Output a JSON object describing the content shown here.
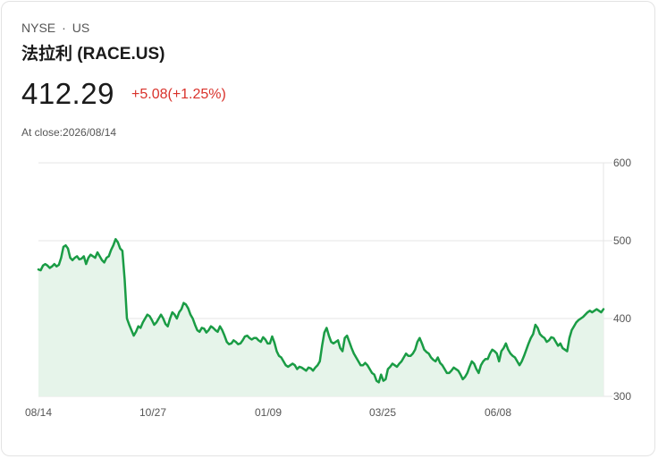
{
  "header": {
    "exchange": "NYSE",
    "separator": "·",
    "market": "US",
    "title": "法拉利 (RACE.US)",
    "price": "412.29",
    "change": "+5.08(+1.25%)",
    "close_label": "At close:",
    "close_date": "2026/08/14"
  },
  "colors": {
    "line": "#1a9c45",
    "area": "#e6f4ea",
    "change": "#d9322b",
    "grid": "#e6e6e6"
  },
  "chart_data": {
    "type": "area",
    "title": "",
    "xlabel": "",
    "ylabel": "",
    "ylim": [
      300,
      600
    ],
    "y_ticks": [
      600,
      500,
      400,
      300
    ],
    "x_tick_labels": [
      "08/14",
      "10/27",
      "01/09",
      "03/25",
      "06/08"
    ],
    "grid": "horizontal",
    "y_axis_position": "right",
    "series": [
      {
        "values": [
          463,
          462,
          468,
          470,
          468,
          465,
          467,
          470,
          467,
          469,
          478,
          492,
          494,
          490,
          478,
          475,
          478,
          480,
          476,
          477,
          480,
          470,
          478,
          482,
          480,
          478,
          485,
          480,
          475,
          472,
          478,
          480,
          488,
          494,
          502,
          498,
          490,
          487,
          450,
          400,
          392,
          385,
          378,
          383,
          390,
          388,
          395,
          400,
          405,
          403,
          398,
          392,
          395,
          400,
          405,
          400,
          393,
          390,
          400,
          408,
          405,
          400,
          408,
          412,
          420,
          418,
          413,
          405,
          400,
          392,
          385,
          383,
          388,
          387,
          382,
          385,
          390,
          388,
          385,
          383,
          390,
          385,
          378,
          370,
          367,
          368,
          372,
          370,
          367,
          368,
          372,
          377,
          378,
          375,
          373,
          375,
          375,
          372,
          370,
          376,
          373,
          368,
          368,
          377,
          369,
          358,
          352,
          350,
          345,
          340,
          338,
          340,
          342,
          340,
          335,
          338,
          337,
          335,
          333,
          337,
          336,
          333,
          337,
          340,
          345,
          365,
          382,
          388,
          378,
          370,
          368,
          370,
          372,
          362,
          358,
          375,
          378,
          370,
          362,
          355,
          350,
          345,
          340,
          340,
          343,
          340,
          335,
          330,
          328,
          320,
          318,
          328,
          320,
          322,
          335,
          338,
          342,
          340,
          338,
          342,
          345,
          350,
          355,
          352,
          352,
          355,
          360,
          370,
          375,
          368,
          360,
          357,
          355,
          350,
          347,
          345,
          350,
          343,
          340,
          335,
          330,
          330,
          333,
          337,
          335,
          333,
          328,
          322,
          325,
          330,
          338,
          345,
          342,
          335,
          330,
          340,
          345,
          348,
          348,
          355,
          360,
          358,
          355,
          345,
          358,
          362,
          368,
          360,
          355,
          352,
          350,
          345,
          340,
          345,
          352,
          360,
          368,
          375,
          380,
          392,
          388,
          380,
          377,
          375,
          370,
          372,
          376,
          375,
          370,
          365,
          368,
          362,
          360,
          358,
          375,
          385,
          390,
          395,
          398,
          400,
          402,
          405,
          408,
          410,
          408,
          410,
          412,
          410,
          408,
          412
        ]
      }
    ]
  }
}
